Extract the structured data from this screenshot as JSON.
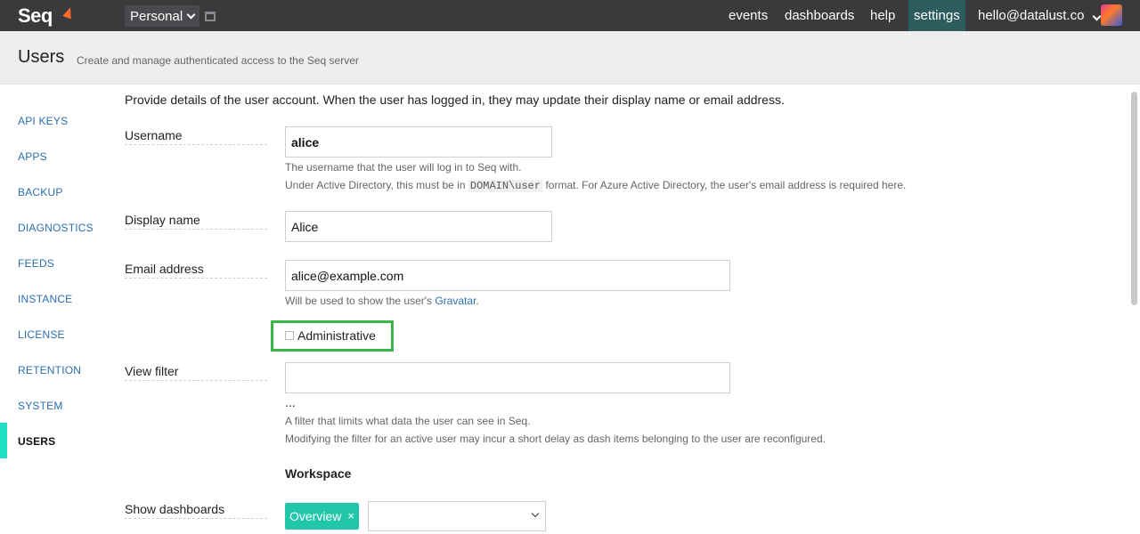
{
  "app": {
    "logo": "Seq",
    "workspace": "Personal"
  },
  "nav": {
    "events": "events",
    "dashboards": "dashboards",
    "help": "help",
    "settings": "settings",
    "user": "hello@datalust.co"
  },
  "page": {
    "title": "Users",
    "subtitle": "Create and manage authenticated access to the Seq server"
  },
  "sidebar": {
    "items": [
      {
        "label": "API KEYS"
      },
      {
        "label": "APPS"
      },
      {
        "label": "BACKUP"
      },
      {
        "label": "DIAGNOSTICS"
      },
      {
        "label": "FEEDS"
      },
      {
        "label": "INSTANCE"
      },
      {
        "label": "LICENSE"
      },
      {
        "label": "RETENTION"
      },
      {
        "label": "SYSTEM"
      },
      {
        "label": "USERS",
        "active": true
      }
    ]
  },
  "form": {
    "intro": "Provide details of the user account. When the user has logged in, they may update their display name or email address.",
    "username": {
      "label": "Username",
      "value": "alice",
      "help1": "The username that the user will log in to Seq with.",
      "help2_prefix": "Under Active Directory, this must be in",
      "help2_code": "DOMAIN\\user",
      "help2_suffix": "format. For Azure Active Directory, the user's email address is required here."
    },
    "display_name": {
      "label": "Display name",
      "value": "Alice"
    },
    "email": {
      "label": "Email address",
      "value": "alice@example.com",
      "help_prefix": "Will be used to show the user's",
      "help_link": "Gravatar",
      "help_suffix": "."
    },
    "administrative": {
      "label": "Administrative",
      "checked": false
    },
    "view_filter": {
      "label": "View filter",
      "value": "",
      "ellipsis": "...",
      "help1": "A filter that limits what data the user can see in Seq.",
      "help2": "Modifying the filter for an active user may incur a short delay as dash items belonging to the user are reconfigured."
    },
    "workspace": {
      "title": "Workspace",
      "show_dashboards_label": "Show dashboards",
      "tag": "Overview",
      "tag_remove": "×"
    }
  }
}
